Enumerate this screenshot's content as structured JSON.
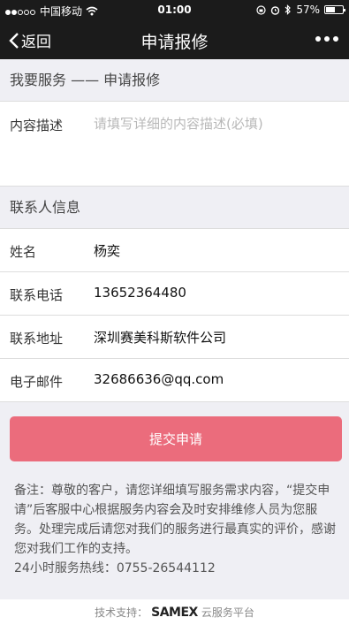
{
  "status_bar": {
    "carrier": "中国移动",
    "time": "01:00",
    "battery": "57%",
    "battery_level": 0.57,
    "icons": [
      "signal-dots-icon",
      "wifi-icon",
      "rotation-lock-icon",
      "alarm-icon",
      "bluetooth-icon",
      "battery-icon"
    ]
  },
  "nav": {
    "back_label": "返回",
    "title": "申请报修",
    "more_icon": "more-dots-icon"
  },
  "section_service": "我要服务 —— 申请报修",
  "description": {
    "label": "内容描述",
    "placeholder": "请填写详细的内容描述(必填)",
    "value": ""
  },
  "section_contact": "联系人信息",
  "contact_rows": [
    {
      "label": "姓名",
      "value": "杨奕"
    },
    {
      "label": "联系电话",
      "value": "13652364480"
    },
    {
      "label": "联系地址",
      "value": "深圳赛美科斯软件公司"
    },
    {
      "label": "电子邮件",
      "value": "32686636@qq.com"
    }
  ],
  "submit_label": "提交申请",
  "note": {
    "text": "备注：尊敬的客户，请您详细填写服务需求内容，“提交申请”后客服中心根据服务内容会及时安排维修人员为您服务。处理完成后请您对我们的服务进行最真实的评价，感谢您对我们工作的支持。",
    "hotline": "24小时服务热线：0755-26544112"
  },
  "footer": {
    "prefix": "技术支持：",
    "brand": "SAMEX",
    "suffix": "云服务平台"
  },
  "colors": {
    "bar_bg": "#1b1b1b",
    "page_bg": "#efeff4",
    "submit_bg": "#eb6c7c"
  }
}
